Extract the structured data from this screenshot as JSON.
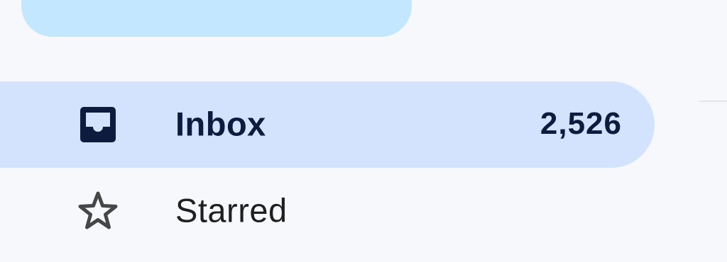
{
  "sidebar": {
    "items": [
      {
        "label": "Inbox",
        "count": "2,526",
        "icon": "inbox-icon",
        "active": true
      },
      {
        "label": "Starred",
        "icon": "star-icon",
        "active": false
      }
    ]
  },
  "colors": {
    "background": "#f6f8fc",
    "compose_button": "#c2e7ff",
    "active_item_background": "#d3e3fd",
    "active_text": "#0b1c3f",
    "text": "#1f1f1f"
  }
}
